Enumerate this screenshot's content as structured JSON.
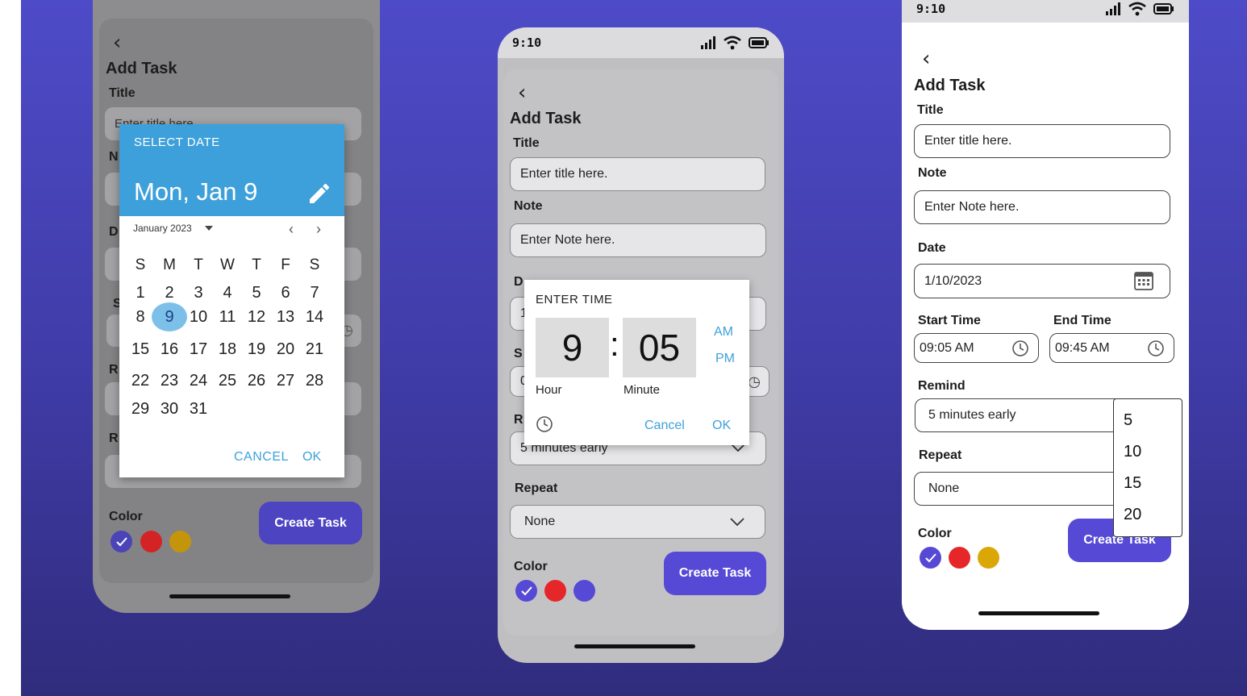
{
  "colors": {
    "accent": "#5649d6",
    "red": "#e6272a",
    "yellow": "#dba706",
    "date_header": "#3ea0da"
  },
  "screen1": {
    "header": "Add Task",
    "title_label": "Title",
    "title_placeholder": "Enter title here.",
    "note_label_partial": "N",
    "date_label_partial": "D",
    "start_label_partial": "S",
    "remind_label_partial": "R",
    "repeat_label_partial": "R",
    "color_label": "Color",
    "create_button": "Create Task",
    "date_picker": {
      "header_label": "SELECT DATE",
      "selected_display": "Mon, Jan 9",
      "month_label": "January 2023",
      "weekdays": [
        "S",
        "M",
        "T",
        "W",
        "T",
        "F",
        "S"
      ],
      "weeks": [
        [
          "1",
          "2",
          "3",
          "4",
          "5",
          "6",
          "7"
        ],
        [
          "8",
          "9",
          "10",
          "11",
          "12",
          "13",
          "14"
        ],
        [
          "15",
          "16",
          "17",
          "18",
          "19",
          "20",
          "21"
        ],
        [
          "22",
          "23",
          "24",
          "25",
          "26",
          "27",
          "28"
        ],
        [
          "29",
          "30",
          "31",
          "",
          "",
          "",
          ""
        ]
      ],
      "selected_day": "9",
      "cancel_label": "CANCEL",
      "ok_label": "OK"
    }
  },
  "screen2": {
    "time": "9:10",
    "header": "Add Task",
    "title_label": "Title",
    "title_placeholder": "Enter title here.",
    "note_label": "Note",
    "note_placeholder": "Enter Note here.",
    "date_label_partial": "D",
    "date_value_partial": "1",
    "start_label_partial": "S",
    "start_value_partial": "0",
    "remind_label_partial": "R",
    "remind_value": "5 minutes early",
    "repeat_label": "Repeat",
    "repeat_value": "None",
    "color_label": "Color",
    "create_button": "Create Task",
    "time_picker": {
      "header_label": "ENTER TIME",
      "hour": "9",
      "separator": ":",
      "minute": "05",
      "am_label": "AM",
      "pm_label": "PM",
      "hour_caption": "Hour",
      "minute_caption": "Minute",
      "cancel_label": "Cancel",
      "ok_label": "OK"
    }
  },
  "screen3": {
    "time": "9:10",
    "header": "Add Task",
    "title_label": "Title",
    "title_placeholder": "Enter title here.",
    "note_label": "Note",
    "note_placeholder": "Enter Note here.",
    "date_label": "Date",
    "date_value": "1/10/2023",
    "start_label": "Start Time",
    "start_value": "09:05 AM",
    "end_label": "End Time",
    "end_value": "09:45 AM",
    "remind_label": "Remind",
    "remind_value": "5 minutes early",
    "repeat_label": "Repeat",
    "repeat_value": "None",
    "color_label": "Color",
    "create_button": "Create Task",
    "remind_options": [
      "5",
      "10",
      "15",
      "20"
    ]
  }
}
